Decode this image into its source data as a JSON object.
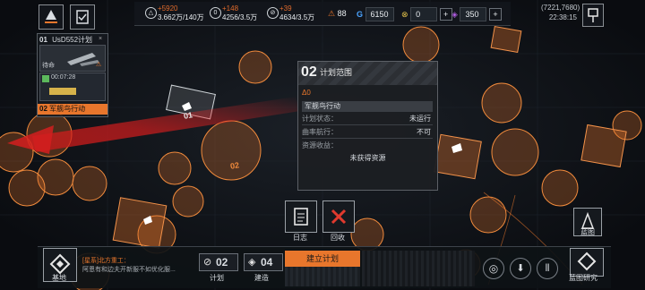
{
  "top": {
    "res1": {
      "delta": "+5920",
      "value": "3.662万/140万"
    },
    "res2": {
      "delta": "+148",
      "value": "4256/3.5万"
    },
    "res3": {
      "delta": "+39",
      "value": "4634/3.5万"
    },
    "energy": "88",
    "credits": "6150",
    "gold": "0",
    "gems": "350",
    "coords": "(7221,7680)",
    "time": "22:38:15"
  },
  "plan_panel": {
    "header_num": "01",
    "header_name": "UsD552计划",
    "item1": "待命",
    "timer": "00:07:28",
    "selected_num": "02",
    "selected_name": "军舰鸟行动"
  },
  "popup": {
    "num": "02",
    "title": "计划范围",
    "delta_badge": "Δ0",
    "op_name": "军舰鸟行动",
    "status_label": "计划状态：",
    "status_value": "未运行",
    "cruise_label": "曲率航行：",
    "cruise_value": "不可",
    "yield_label": "资源收益：",
    "yield_value": "未获得资源"
  },
  "map_labels": {
    "marker1": "01",
    "marker2": "02"
  },
  "actions": {
    "log": "日志",
    "recall": "回收"
  },
  "bottom": {
    "base": "基地",
    "chat_channel": "[星系]",
    "chat_sender": "北方重工：",
    "chat_text": "阿恩有和边夫开新服不如优化服...",
    "plan_count": "02",
    "plan_label": "计划",
    "build_count": "04",
    "build_label": "建造",
    "create_plan": "建立计划",
    "blueprint": "蓝图",
    "blueprint_research": "蓝图研究"
  },
  "colors": {
    "accent": "#e8762c",
    "panel": "#1c1f24"
  }
}
